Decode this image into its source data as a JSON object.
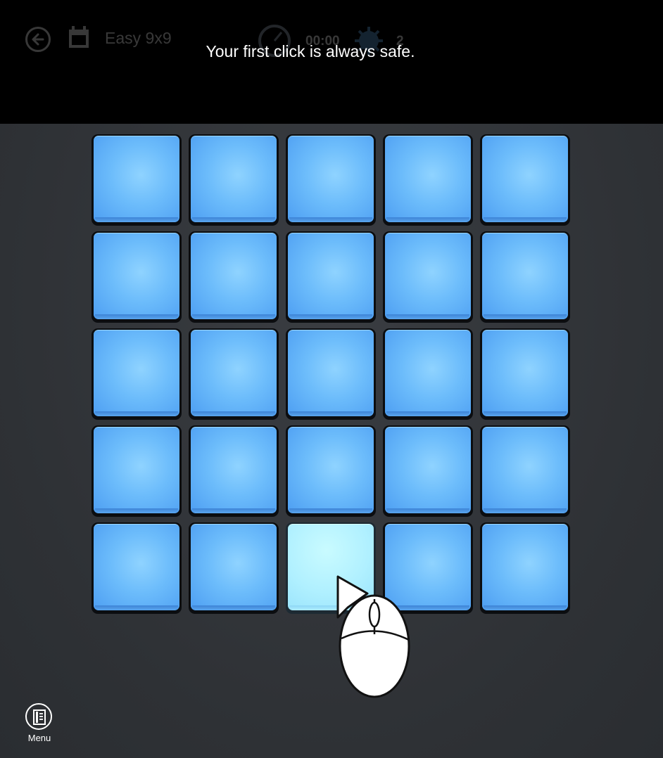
{
  "header": {
    "level_name": "Easy 9x9",
    "timer": "00:00",
    "mine_count": "2"
  },
  "tutorial": {
    "message": "Your first click is always safe."
  },
  "board": {
    "rows": 5,
    "cols": 5,
    "tile_state": "unrevealed",
    "highlighted_tile": {
      "row": 5,
      "col": 3
    },
    "tile_color": "#6cbcfb",
    "highlight_color": "#b0f0ff"
  },
  "appbar": {
    "menu_label": "Menu"
  },
  "icons": {
    "back": "back-arrow-icon",
    "level": "calendar-icon",
    "timer": "stopwatch-icon",
    "mines": "mine-icon",
    "menu": "menu-list-icon",
    "hint": "mouse-click-icon"
  }
}
